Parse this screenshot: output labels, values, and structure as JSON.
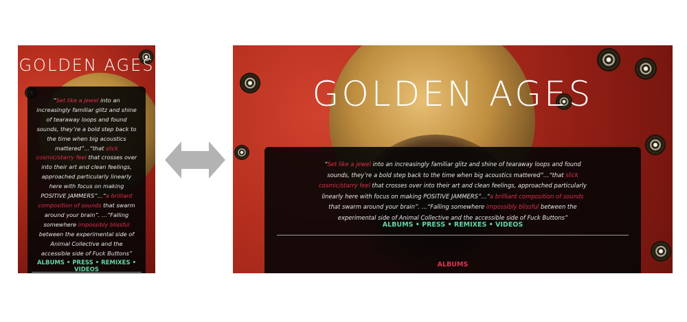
{
  "site": {
    "title": "GOLDEN AGES"
  },
  "quote": {
    "open": "“",
    "pink1": "Set like a jewel",
    "t1": " into an increasingly familiar glitz and shine of tearaway loops and found sounds, they’re a bold step back to the time when big acoustics mattered”…“that ",
    "pink2": "slick cosmic/starry feel",
    "t2": " that crosses over into their art and clean feelings, approached particularly linearly here with focus on making POSITIVE JAMMERS”…“",
    "pink3": "a brilliant composition of sounds",
    "t3": " that swarm around your brain”. …“Falling somewhere ",
    "pink4": "impossibly blissful",
    "t4": " between the experimental side of Animal Collective and the accessible side of Fuck Buttons”"
  },
  "nav": {
    "items": [
      "ALBUMS",
      "PRESS",
      "REMIXES",
      "VIDEOS"
    ],
    "separator": "•"
  },
  "section": {
    "heading": "ALBUMS"
  },
  "colors": {
    "accent_pink": "#e0304e",
    "nav_green": "#5fd7a4",
    "arrow_gray": "#b3b3b3"
  },
  "icons": {
    "compare_arrow": "double-arrow-icon"
  }
}
